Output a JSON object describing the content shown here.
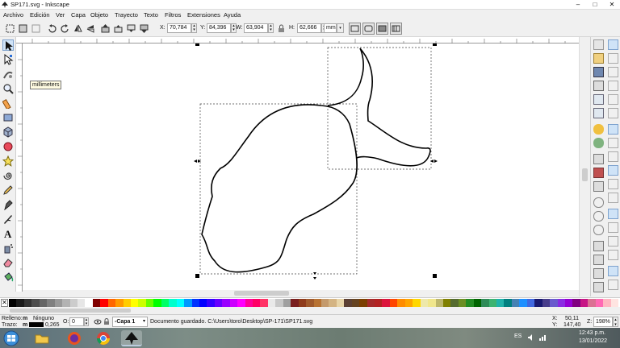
{
  "window": {
    "title": "SP171.svg - Inkscape",
    "minimize": "–",
    "maximize": "□",
    "close": "✕"
  },
  "menu": [
    "Archivo",
    "Edición",
    "Ver",
    "Capa",
    "Objeto",
    "Trayecto",
    "Texto",
    "Filtros",
    "Extensiones",
    "Ayuda"
  ],
  "toolbar": {
    "x_label": "X:",
    "x_value": "70,784",
    "y_label": "Y:",
    "y_value": "84,396",
    "w_label": "W:",
    "w_value": "63,904",
    "h_label": "H:",
    "h_value": "62,666",
    "unit": "mm"
  },
  "tooltip": "millimeters",
  "status": {
    "fill_label": "Relleno:",
    "fill_value": "m",
    "stroke_label": "Trazo:",
    "stroke_value": "m",
    "fill_none": "Ninguno",
    "stroke_width": "0,265",
    "opacity_label": "O:",
    "opacity_value": "0",
    "layer": "-Capa 1",
    "message": "Documento guardado. C:\\Users\\toro\\Desktop\\SP-171\\SP171.svg",
    "cursor_x_label": "X:",
    "cursor_x": "50,11",
    "cursor_y_label": "Y:",
    "cursor_y": "147,40",
    "zoom_label": "Z:",
    "zoom": "198%"
  },
  "taskbar": {
    "language": "ES",
    "time": "12:43 p.m.",
    "date": "13/01/2022"
  },
  "colors": {
    "selection_dash": "#444444",
    "swatches": [
      "#000000",
      "#1a1a1a",
      "#333333",
      "#4d4d4d",
      "#666666",
      "#808080",
      "#999999",
      "#b3b3b3",
      "#cccccc",
      "#e6e6e6",
      "#ffffff",
      "#800000",
      "#ff0000",
      "#ff6600",
      "#ff9900",
      "#ffcc00",
      "#ffff00",
      "#ccff00",
      "#66ff00",
      "#00ff00",
      "#00ff66",
      "#00ffcc",
      "#00ffff",
      "#0099ff",
      "#0033ff",
      "#0000ff",
      "#3300ff",
      "#6600ff",
      "#9900ff",
      "#cc00ff",
      "#ff00ff",
      "#ff0099",
      "#ff0066",
      "#ff3366",
      "#e9e9e9",
      "#c8c8c8",
      "#a0a0a0",
      "#7a1f1f",
      "#8f3b1b",
      "#a05a2c",
      "#b87333",
      "#c49a6c",
      "#d4b483",
      "#e8d5a9",
      "#5c4033",
      "#654321",
      "#7b3f00",
      "#a52a2a",
      "#b22222",
      "#dc143c",
      "#ff4500",
      "#ff8c00",
      "#ffa500",
      "#ffd700",
      "#eee8aa",
      "#f0e68c",
      "#bdb76b",
      "#808000",
      "#556b2f",
      "#6b8e23",
      "#228b22",
      "#006400",
      "#2e8b57",
      "#3cb371",
      "#20b2aa",
      "#008080",
      "#4682b4",
      "#1e90ff",
      "#4169e1",
      "#191970",
      "#483d8b",
      "#6a5acd",
      "#8a2be2",
      "#9400d3",
      "#800080",
      "#c71585",
      "#db7093",
      "#ff69b4",
      "#ffb6c1",
      "#ffe4e1"
    ]
  }
}
